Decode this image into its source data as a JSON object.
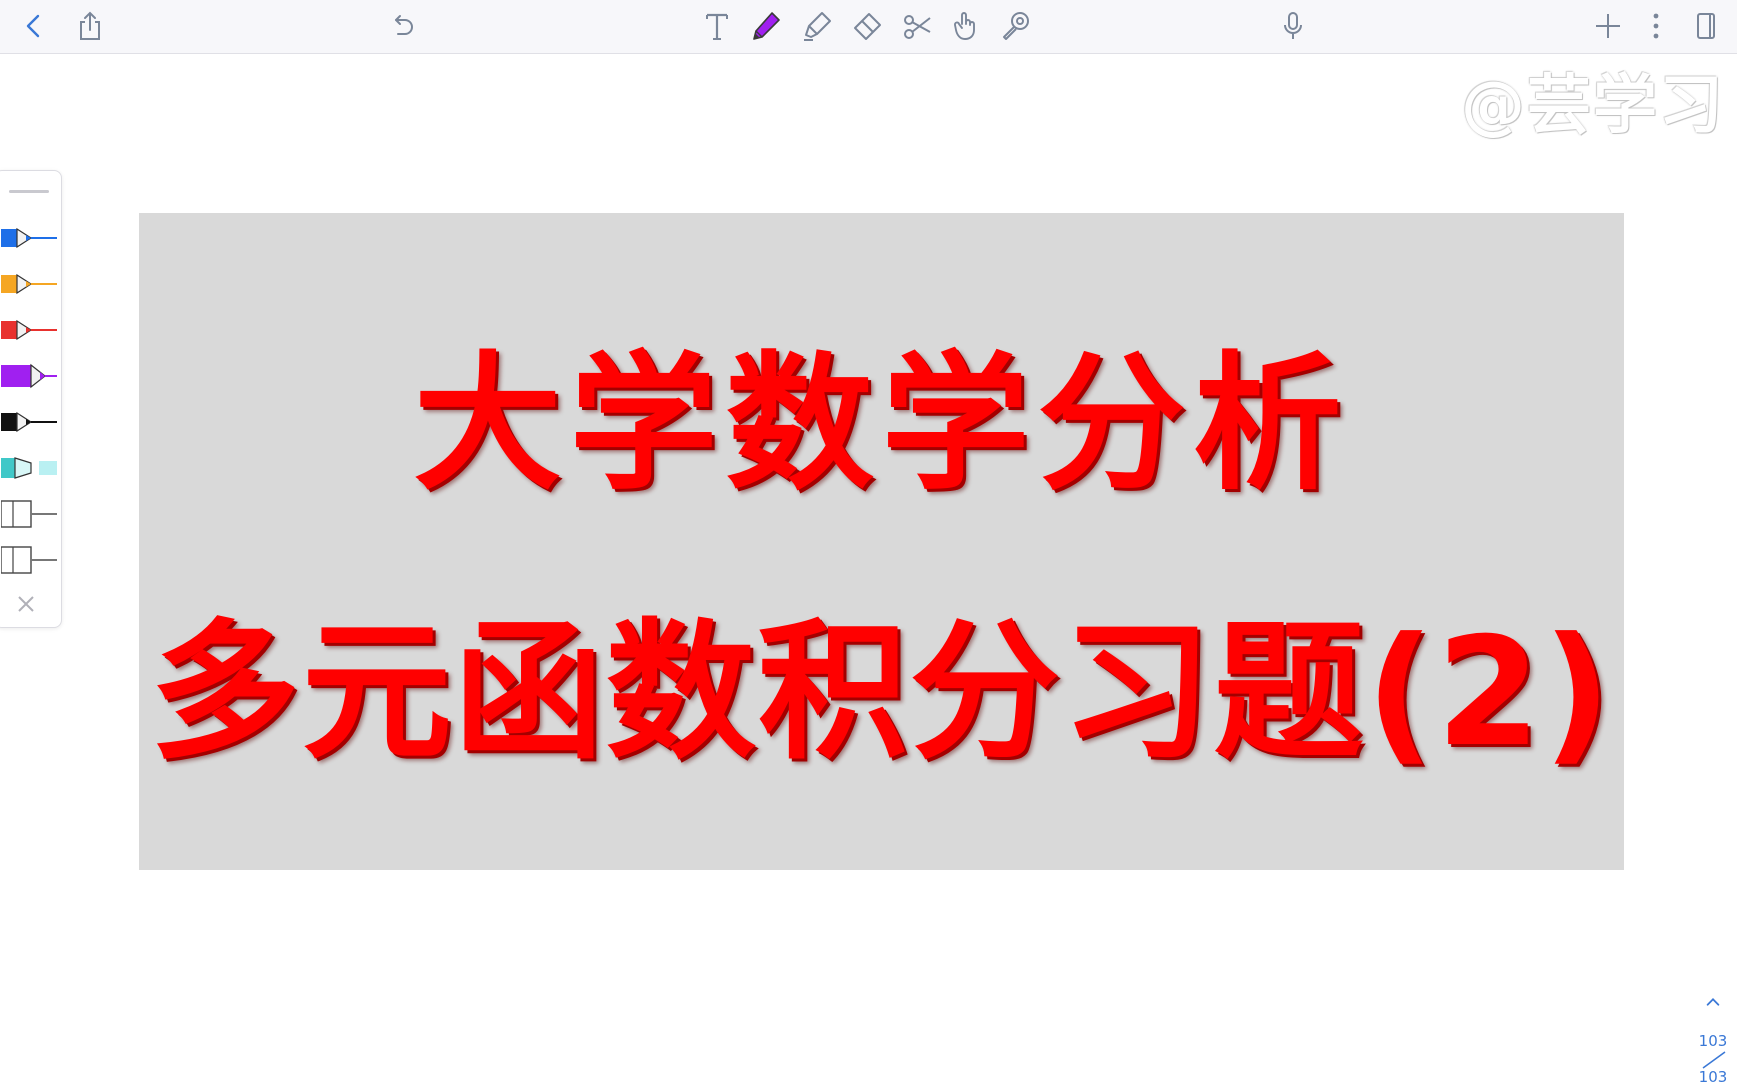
{
  "toolbar": {
    "left": [
      "back-icon",
      "share-icon"
    ],
    "undo": "undo-icon",
    "tools": [
      "text-tool-icon",
      "pen-tool-icon",
      "highlighter-tool-icon",
      "eraser-tool-icon",
      "scissors-tool-icon",
      "pointer-tool-icon",
      "laser-tool-icon"
    ],
    "right": [
      "microphone-icon",
      "add-icon",
      "more-icon",
      "page-layout-icon"
    ],
    "active_tool": "pen-tool-icon",
    "accent_color": "#3a78d6",
    "active_pen_color": "#a020f0"
  },
  "watermark": {
    "text": "@芸学习"
  },
  "palette": {
    "pens": [
      {
        "name": "blue-pen",
        "color": "#1e6fe8"
      },
      {
        "name": "orange-pen",
        "color": "#f5a623"
      },
      {
        "name": "red-pen",
        "color": "#e8312e"
      },
      {
        "name": "purple-pen",
        "color": "#a020f0"
      },
      {
        "name": "black-pen",
        "color": "#111111"
      },
      {
        "name": "cyan-highlighter",
        "color": "#7fe0e6"
      },
      {
        "name": "gray-marker-1",
        "color": "#777777"
      },
      {
        "name": "gray-marker-2",
        "color": "#777777"
      }
    ]
  },
  "slide": {
    "background": "#d9d9d9",
    "line1": "大学数学分析",
    "line2": "多元函数积分习题(2)",
    "text_color": "#ff0000"
  },
  "page_nav": {
    "current": "103",
    "total": "103"
  }
}
